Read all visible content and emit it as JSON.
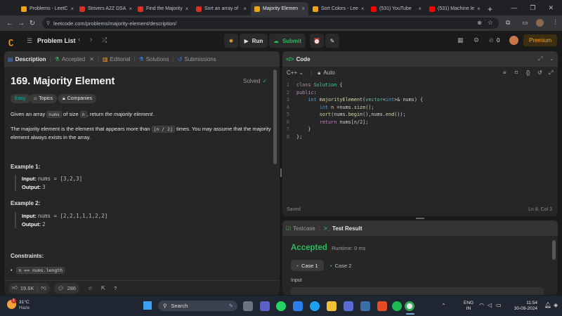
{
  "browser": {
    "tabs": [
      {
        "title": "Problems - LeetC",
        "color": "#f0a31a",
        "active": false
      },
      {
        "title": "Strivers A2Z DSA",
        "color": "#d93025",
        "active": false
      },
      {
        "title": "Find the Majority",
        "color": "#d93025",
        "active": false
      },
      {
        "title": "Sort an array of",
        "color": "#d93025",
        "active": false
      },
      {
        "title": "Majority Elemen",
        "color": "#f0a31a",
        "active": true
      },
      {
        "title": "Sort Colors - Lee",
        "color": "#f0a31a",
        "active": false
      },
      {
        "title": "(531) YouTube",
        "color": "#ff0000",
        "active": false
      },
      {
        "title": "(531) Machine le",
        "color": "#ff0000",
        "active": false
      }
    ],
    "url": "leetcode.com/problems/majority-element/description/"
  },
  "lc": {
    "problem_list": "Problem List",
    "run": "Run",
    "submit": "Submit",
    "streak": "0",
    "premium": "Premium"
  },
  "left": {
    "tabs": [
      "Description",
      "Accepted",
      "Editorial",
      "Solutions",
      "Submissions"
    ],
    "title": "169. Majority Element",
    "solved": "Solved",
    "difficulty": "Easy",
    "topics": "Topics",
    "companies": "Companies",
    "desc1_a": "Given an array ",
    "desc1_code": "nums",
    "desc1_b": " of size ",
    "desc1_code2": "n",
    "desc1_c": ", return ",
    "desc1_em": "the majority element",
    "desc1_d": ".",
    "desc2_a": "The majority element is the element that appears more than ",
    "desc2_code": "⌊n / 2⌋",
    "desc2_b": " times. You may assume that the majority element always exists in the array.",
    "ex1_title": "Example 1:",
    "ex1_input_label": "Input:",
    "ex1_input": "nums = [3,2,3]",
    "ex1_output_label": "Output:",
    "ex1_output": "3",
    "ex2_title": "Example 2:",
    "ex2_input_label": "Input:",
    "ex2_input": "nums = [2,2,1,1,1,2,2]",
    "ex2_output_label": "Output:",
    "ex2_output": "2",
    "constraints_title": "Constraints:",
    "constraint1": "n == nums.length",
    "likes": "19.6K",
    "comments": "286"
  },
  "code": {
    "title": "Code",
    "lang": "C++",
    "mode": "Auto",
    "saved": "Saved",
    "cursor": "Ln 8, Col 3"
  },
  "result": {
    "testcase_tab": "Testcase",
    "result_tab": "Test Result",
    "status": "Accepted",
    "runtime": "Runtime: 0 ms",
    "case1": "Case 1",
    "case2": "Case 2",
    "input_label": "Input"
  },
  "taskbar": {
    "temp": "31°C",
    "weather": "Haze",
    "search": "Search",
    "lang1": "ENG",
    "lang2": "IN",
    "time": "11:54",
    "date": "30-09-2024"
  }
}
